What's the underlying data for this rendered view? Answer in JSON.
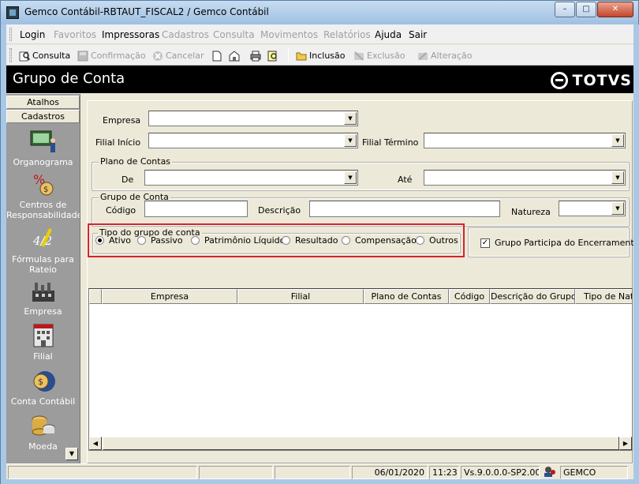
{
  "window": {
    "title": "Gemco Contábil-RBTAUT_FISCAL2 / Gemco Contábil",
    "min_label": "–",
    "max_label": "□",
    "close_label": "✕"
  },
  "menu": [
    {
      "label": "Login",
      "enabled": true
    },
    {
      "label": "Favoritos",
      "enabled": false
    },
    {
      "label": "Impressoras",
      "enabled": true
    },
    {
      "label": "Cadastros",
      "enabled": false
    },
    {
      "label": "Consulta",
      "enabled": false
    },
    {
      "label": "Movimentos",
      "enabled": false
    },
    {
      "label": "Relatórios",
      "enabled": false
    },
    {
      "label": "Ajuda",
      "enabled": true
    },
    {
      "label": "Sair",
      "enabled": true
    }
  ],
  "toolbar": {
    "consulta": "Consulta",
    "confirmacao": "Confirmação",
    "cancelar": "Cancelar",
    "inclusao": "Inclusão",
    "exclusao": "Exclusão",
    "alteracao": "Alteração"
  },
  "header": {
    "title": "Grupo de Conta",
    "brand": "TOTVS"
  },
  "sidebar": {
    "atalhos": "Atalhos",
    "cadastros": "Cadastros",
    "items": [
      {
        "label": "Organograma"
      },
      {
        "label": "Centros de Responsabilidade"
      },
      {
        "label": "Fórmulas para Rateio"
      },
      {
        "label": "Empresa"
      },
      {
        "label": "Filial"
      },
      {
        "label": "Conta Contábil"
      },
      {
        "label": "Moeda"
      }
    ]
  },
  "form": {
    "empresa_label": "Empresa",
    "filial_inicio_label": "Filial Início",
    "filial_termino_label": "Filial Término",
    "plano_de_contas_legend": "Plano de Contas",
    "de_label": "De",
    "ate_label": "Até",
    "grupo_de_conta_legend": "Grupo de Conta",
    "codigo_label": "Código",
    "descricao_label": "Descrição",
    "natureza_label": "Natureza",
    "tipo_legend": "Tipo do grupo de conta",
    "tipos": [
      {
        "label": "Ativo",
        "selected": true
      },
      {
        "label": "Passivo",
        "selected": false
      },
      {
        "label": "Patrimônio Líquido",
        "selected": false
      },
      {
        "label": "Resultado",
        "selected": false
      },
      {
        "label": "Compensação",
        "selected": false
      },
      {
        "label": "Outros",
        "selected": false
      }
    ],
    "encerramento_label": "Grupo Participa do Encerramento",
    "encerramento_checked": true
  },
  "grid": {
    "columns": [
      "Empresa",
      "Filial",
      "Plano de Contas",
      "Código",
      "Descrição do Grupo",
      "Tipo de Natur"
    ]
  },
  "status": {
    "date": "06/01/2020",
    "time": "11:23",
    "version": "Vs.9.0.0.0-SP2.00.0",
    "user": "GEMCO"
  },
  "colors": {
    "header_bg": "#000000",
    "highlight": "#d8222a",
    "sidebar_bg": "#9c9c9c"
  }
}
